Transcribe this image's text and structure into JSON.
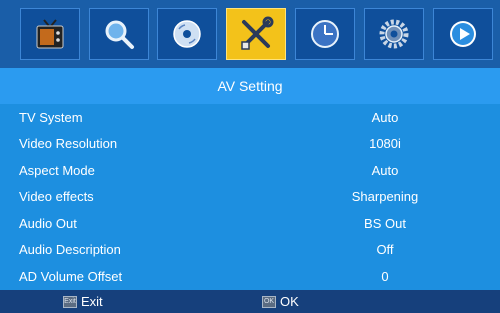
{
  "tabs": [
    {
      "icon": "tv-icon",
      "active": false
    },
    {
      "icon": "search-icon",
      "active": false
    },
    {
      "icon": "disc-icon",
      "active": false
    },
    {
      "icon": "tools-icon",
      "active": true
    },
    {
      "icon": "clock-icon",
      "active": false
    },
    {
      "icon": "gear-icon",
      "active": false
    },
    {
      "icon": "play-icon",
      "active": false
    }
  ],
  "page": {
    "title": "AV Setting"
  },
  "settings": [
    {
      "label": "TV System",
      "value": "Auto"
    },
    {
      "label": "Video Resolution",
      "value": "1080i"
    },
    {
      "label": "Aspect Mode",
      "value": "Auto"
    },
    {
      "label": "Video effects",
      "value": "Sharpening"
    },
    {
      "label": "Audio Out",
      "value": "BS Out"
    },
    {
      "label": "Audio Description",
      "value": "Off"
    },
    {
      "label": "AD Volume Offset",
      "value": "0"
    }
  ],
  "footer": {
    "exit_key": "Exit",
    "exit_label": "Exit",
    "ok_key": "OK",
    "ok_label": "OK"
  },
  "colors": {
    "background": "#1d8fe0",
    "active_tab": "#f3c21a",
    "footer": "#16407c"
  }
}
